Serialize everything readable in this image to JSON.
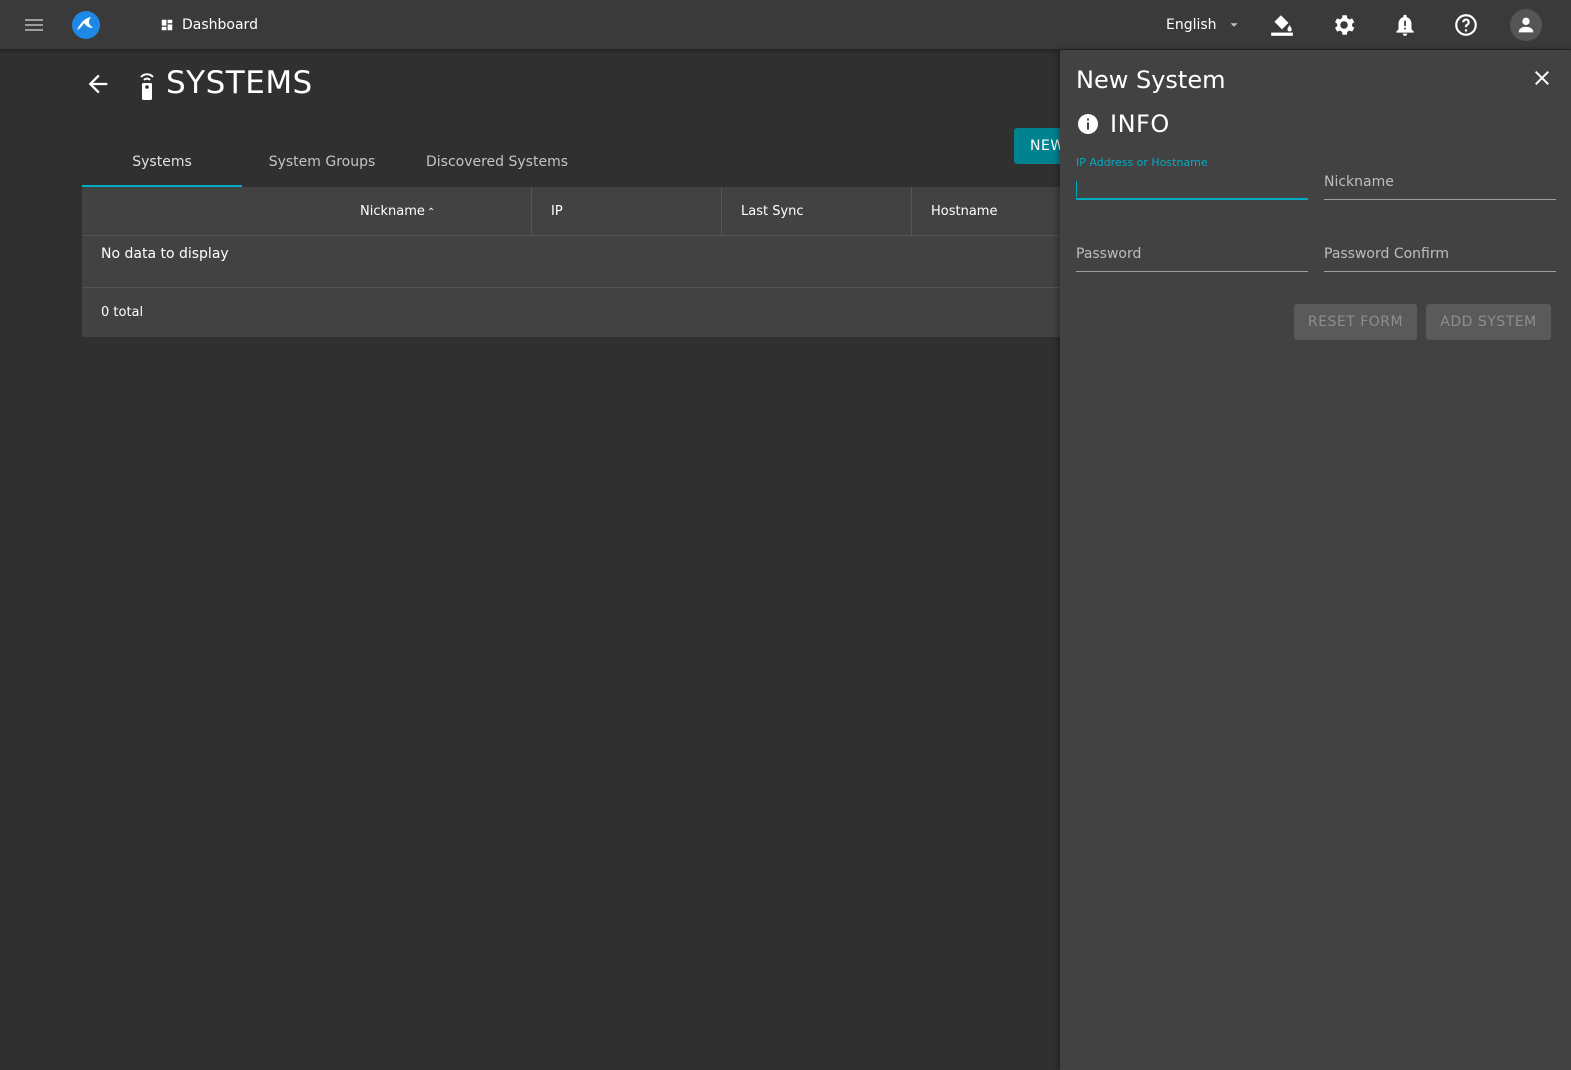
{
  "topbar": {
    "dashboard_label": "Dashboard",
    "language": "English",
    "icons": [
      "menu-icon",
      "app-logo",
      "dashboard-icon",
      "chevron-down-icon",
      "paint-bucket-icon",
      "gear-icon",
      "bell-icon",
      "help-icon",
      "account-icon"
    ]
  },
  "page": {
    "title": "SYSTEMS",
    "new_button": "NEW"
  },
  "tabs": [
    "Systems",
    "System Groups",
    "Discovered Systems"
  ],
  "table": {
    "columns": [
      "Nickname",
      "IP",
      "Last Sync",
      "Hostname"
    ],
    "sort_indicator": "⌃",
    "empty_message": "No data to display",
    "total": "0 total"
  },
  "panel": {
    "title": "New System",
    "section": "INFO",
    "fields": {
      "ip_label": "IP Address or Hostname",
      "nickname_label": "Nickname",
      "password_label": "Password",
      "password_confirm_label": "Password Confirm"
    },
    "reset_button": "RESET FORM",
    "add_button": "ADD SYSTEM"
  },
  "colors": {
    "accent": "#00acc1",
    "button_primary": "#00838f",
    "background": "#303030",
    "surface": "#424242"
  }
}
